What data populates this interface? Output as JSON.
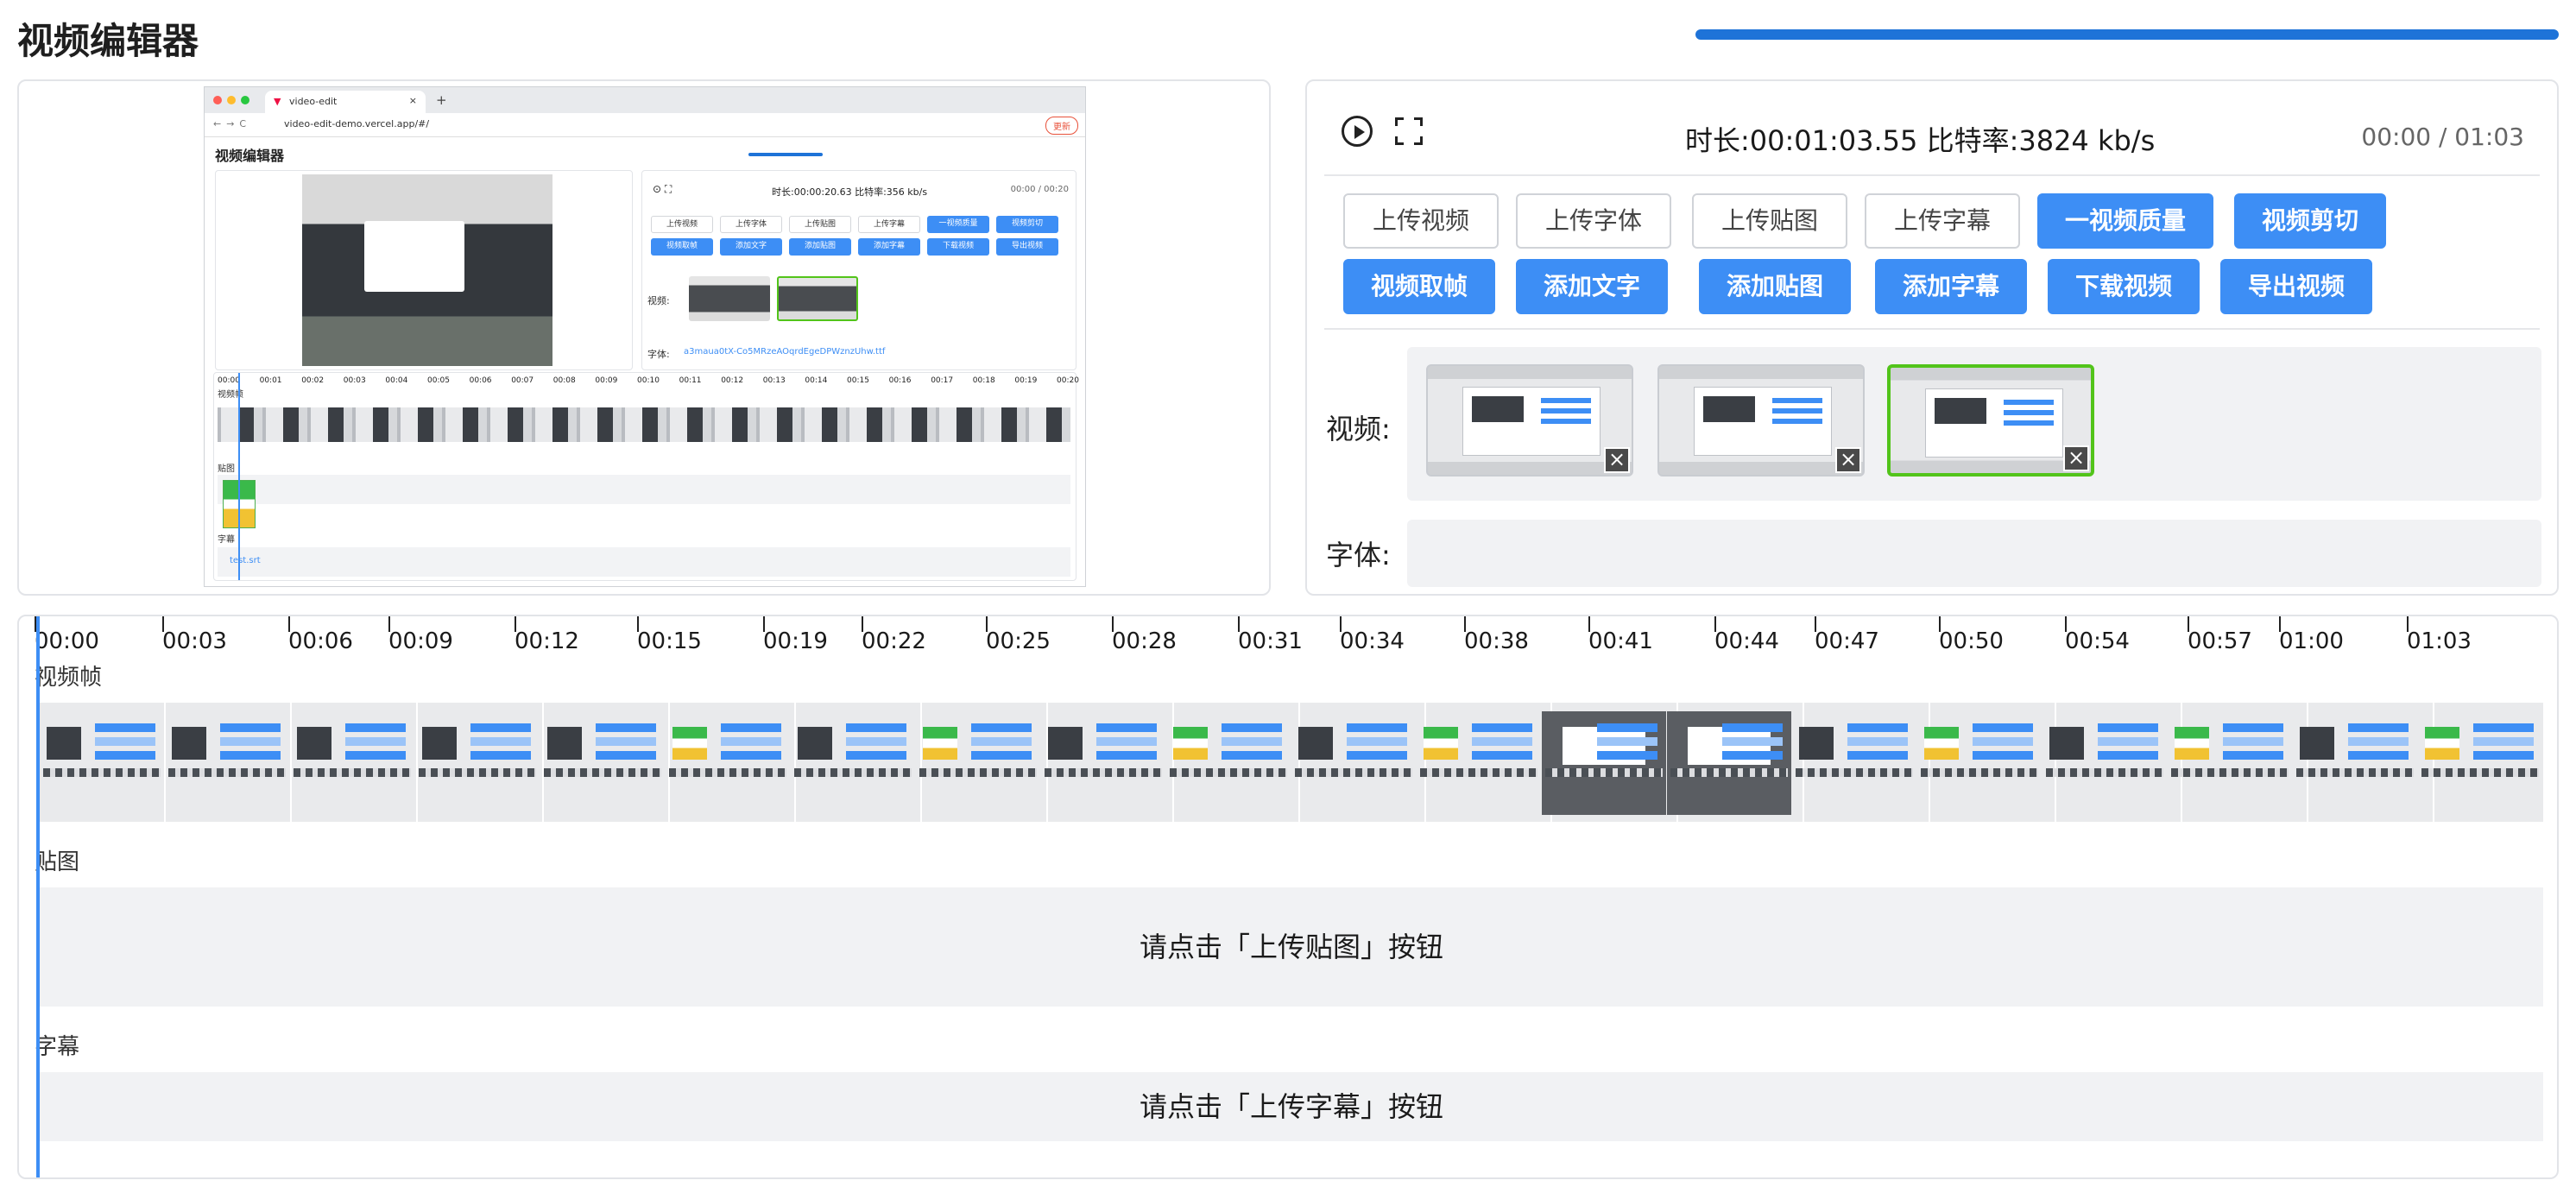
{
  "app": {
    "title": "视频编辑器",
    "progress": 1.0
  },
  "preview": {
    "browser_tab": "video-edit",
    "url": "video-edit-demo.vercel.app/#/",
    "update_label": "更新",
    "app_title": "视频编辑器",
    "meta": "时长:00:00:20.63 比特率:356 kb/s",
    "time": "00:00 / 00:20",
    "buttons_row1": [
      "上传视频",
      "上传字体",
      "上传贴图",
      "上传字幕",
      "一视频质量",
      "视频剪切"
    ],
    "buttons_row2": [
      "视频取帧",
      "添加文字",
      "添加贴图",
      "添加字幕",
      "下载视频",
      "导出视频"
    ],
    "video_label": "视频:",
    "font_label": "字体:",
    "font_value": "a3maua0tX-Co5MRzeAOqrdEgeDPWznzUhw.ttf",
    "ticks": [
      "00:00",
      "00:01",
      "00:02",
      "00:03",
      "00:04",
      "00:05",
      "00:06",
      "00:07",
      "00:08",
      "00:09",
      "00:10",
      "00:11",
      "00:12",
      "00:13",
      "00:14",
      "00:15",
      "00:16",
      "00:17",
      "00:18",
      "00:19",
      "00:20"
    ],
    "track_frames": "视频帧",
    "track_sticker": "贴图",
    "track_subtitle": "字幕",
    "subtitle_file": "test.srt"
  },
  "controls": {
    "meta": "时长:00:01:03.55 比特率:3824 kb/s",
    "time": "00:00 / 01:03",
    "buttons_row1": [
      {
        "label": "上传视频",
        "style": "outline"
      },
      {
        "label": "上传字体",
        "style": "outline"
      },
      {
        "label": "上传贴图",
        "style": "outline"
      },
      {
        "label": "上传字幕",
        "style": "outline"
      },
      {
        "label": "一视频质量",
        "style": "fill"
      },
      {
        "label": "视频剪切",
        "style": "fill"
      }
    ],
    "buttons_row2": [
      {
        "label": "视频取帧",
        "style": "fill"
      },
      {
        "label": "添加文字",
        "style": "fill"
      },
      {
        "label": "添加贴图",
        "style": "fill"
      },
      {
        "label": "添加字幕",
        "style": "fill"
      },
      {
        "label": "下载视频",
        "style": "fill"
      },
      {
        "label": "导出视频",
        "style": "fill"
      }
    ],
    "video_label": "视频:",
    "font_label": "字体:",
    "video_thumbnails": [
      {
        "name": "clip-1",
        "selected": false
      },
      {
        "name": "clip-2",
        "selected": false
      },
      {
        "name": "clip-3",
        "selected": true
      }
    ]
  },
  "timeline": {
    "ticks": [
      "00:00",
      "00:03",
      "00:06",
      "00:09",
      "00:12",
      "00:15",
      "00:19",
      "00:22",
      "00:25",
      "00:28",
      "00:31",
      "00:34",
      "00:38",
      "00:41",
      "00:44",
      "00:47",
      "00:50",
      "00:54",
      "00:57",
      "01:00",
      "01:03"
    ],
    "track_frames": "视频帧",
    "track_sticker": "贴图",
    "track_subtitle": "字幕",
    "sticker_placeholder": "请点击「上传贴图」按钮",
    "subtitle_placeholder": "请点击「上传字幕」按钮"
  },
  "colors": {
    "accent": "#3d8ef5",
    "progress": "#1e73d8",
    "selected_border": "#52c41a"
  },
  "icons": [
    "play-icon",
    "fullscreen-icon",
    "close-icon"
  ]
}
